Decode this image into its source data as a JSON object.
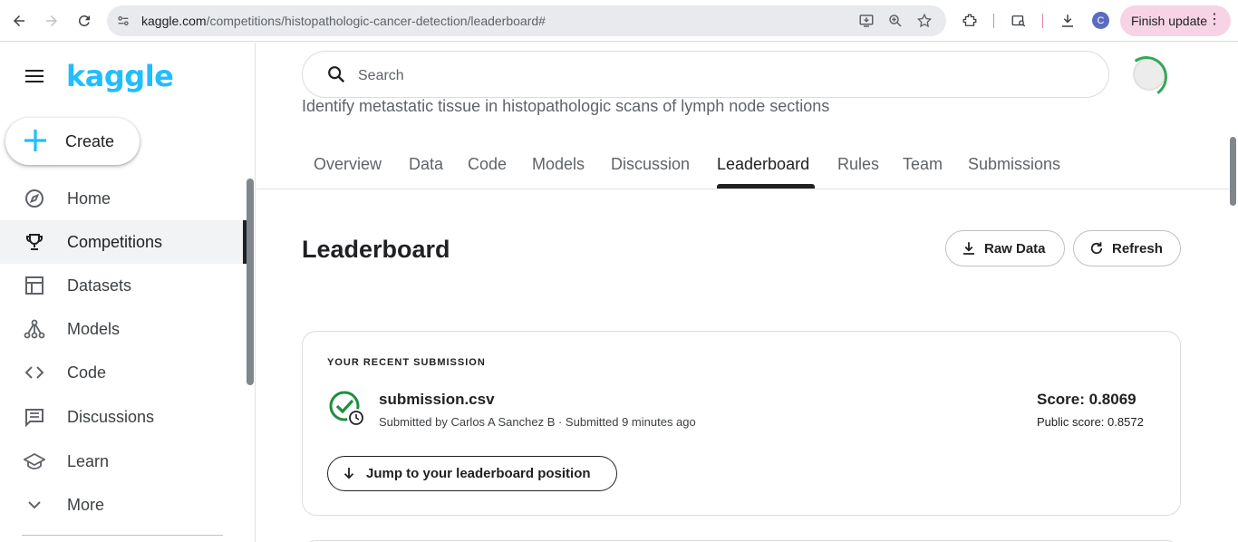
{
  "browser": {
    "url_host": "kaggle.com",
    "url_path": "/competitions/histopathologic-cancer-detection/leaderboard#",
    "profile_initial": "C",
    "finish_update_label": "Finish update"
  },
  "sidebar": {
    "logo": "kaggle",
    "create_label": "Create",
    "items": [
      {
        "label": "Home",
        "icon": "compass-icon"
      },
      {
        "label": "Competitions",
        "icon": "trophy-icon",
        "active": true
      },
      {
        "label": "Datasets",
        "icon": "table-icon"
      },
      {
        "label": "Models",
        "icon": "models-icon"
      },
      {
        "label": "Code",
        "icon": "code-icon"
      },
      {
        "label": "Discussions",
        "icon": "discussion-icon"
      },
      {
        "label": "Learn",
        "icon": "school-icon"
      },
      {
        "label": "More",
        "icon": "chevron-down-icon"
      }
    ]
  },
  "header": {
    "search_placeholder": "Search",
    "subtitle": "Identify metastatic tissue in histopathologic scans of lymph node sections"
  },
  "tabs": [
    {
      "label": "Overview"
    },
    {
      "label": "Data"
    },
    {
      "label": "Code"
    },
    {
      "label": "Models"
    },
    {
      "label": "Discussion"
    },
    {
      "label": "Leaderboard",
      "active": true
    },
    {
      "label": "Rules"
    },
    {
      "label": "Team"
    },
    {
      "label": "Submissions"
    }
  ],
  "leaderboard": {
    "title": "Leaderboard",
    "raw_data_label": "Raw Data",
    "refresh_label": "Refresh"
  },
  "recent_submission": {
    "kicker": "YOUR RECENT SUBMISSION",
    "filename": "submission.csv",
    "meta": "Submitted by Carlos A Sanchez B · Submitted 9 minutes ago",
    "score": "Score: 0.8069",
    "public_score": "Public score: 0.8572",
    "jump_label": "Jump to your leaderboard position"
  },
  "colors": {
    "brand": "#20beff",
    "success": "#1e8e3e",
    "text": "#202124"
  }
}
